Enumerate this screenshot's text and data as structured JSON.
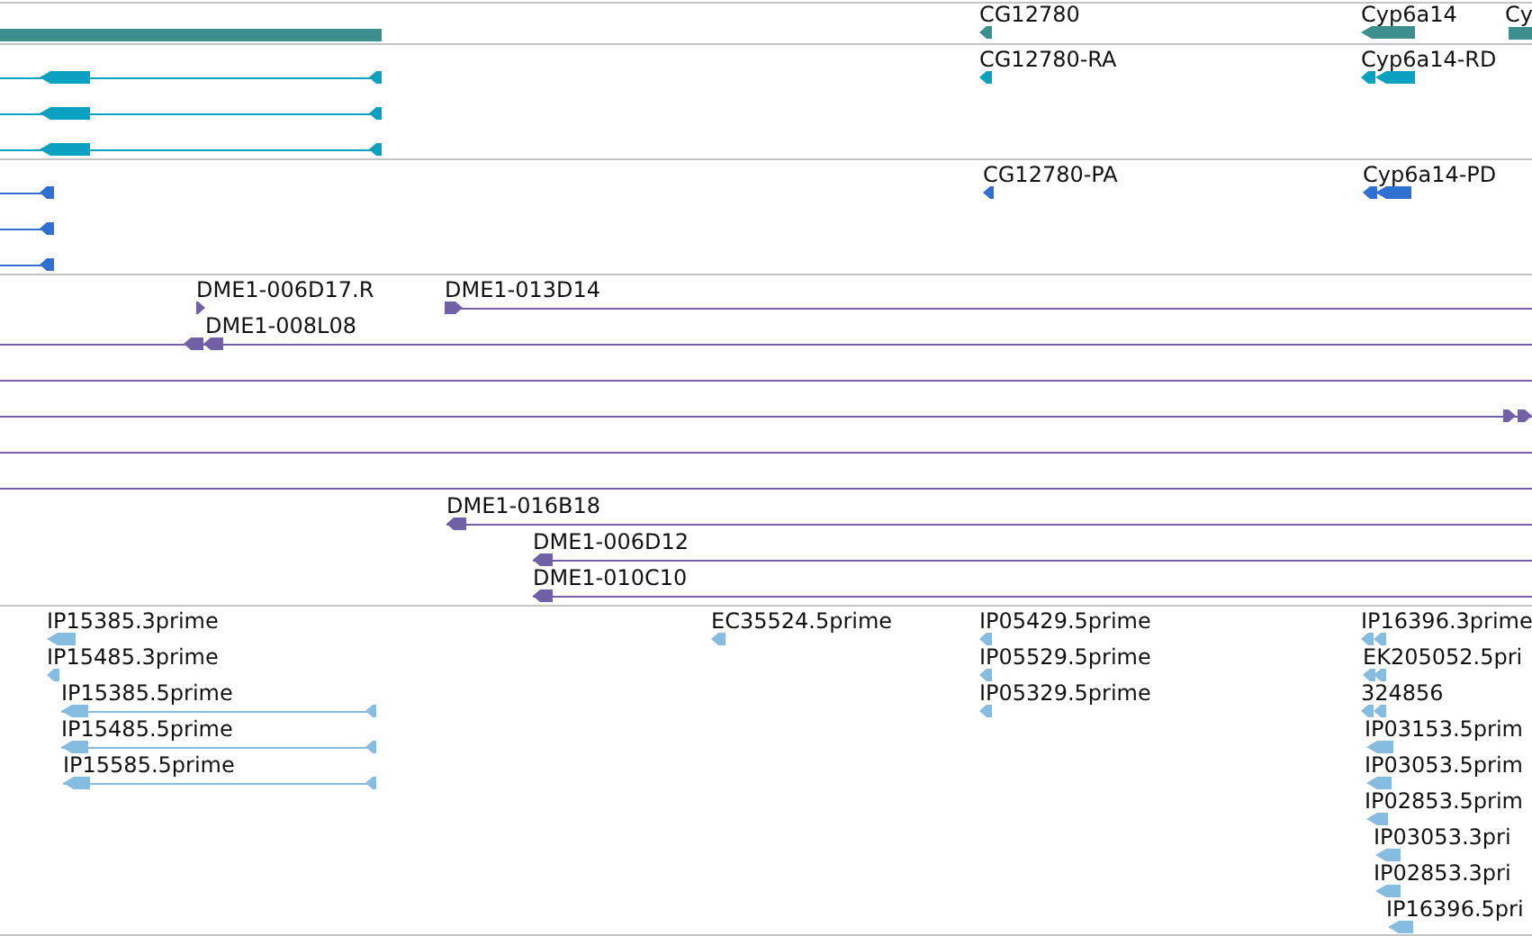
{
  "tracks": [
    {
      "color": "#3d8f8f",
      "features": [
        {
          "label": "CG12780"
        },
        {
          "label": "Cyp6a14"
        },
        {
          "label": "Cy"
        }
      ]
    },
    {
      "color": "#0aa0c0",
      "features": [
        {
          "label": "CG12780-RA"
        },
        {
          "label": "Cyp6a14-RD"
        }
      ]
    },
    {
      "color": "#3070d0",
      "features": [
        {
          "label": "CG12780-PA"
        },
        {
          "label": "Cyp6a14-PD"
        }
      ]
    },
    {
      "color": "#7060a8",
      "features": [
        {
          "label": "DME1-006D17.R"
        },
        {
          "label": "DME1-013D14"
        },
        {
          "label": "DME1-008L08"
        },
        {
          "label": "DME1-016B18"
        },
        {
          "label": "DME1-006D12"
        },
        {
          "label": "DME1-010C10"
        }
      ]
    },
    {
      "color": "#86bce0",
      "features": [
        {
          "label": "IP15385.3prime"
        },
        {
          "label": "IP15485.3prime"
        },
        {
          "label": "IP15385.5prime"
        },
        {
          "label": "IP15485.5prime"
        },
        {
          "label": "IP15585.5prime"
        },
        {
          "label": "EC35524.5prime"
        },
        {
          "label": "IP05429.5prime"
        },
        {
          "label": "IP05529.5prime"
        },
        {
          "label": "IP05329.5prime"
        },
        {
          "label": "IP16396.3prime"
        },
        {
          "label": "EK205052.5pri"
        },
        {
          "label": "324856"
        },
        {
          "label": "IP03153.5prim"
        },
        {
          "label": "IP03053.5prim"
        },
        {
          "label": "IP02853.5prim"
        },
        {
          "label": "IP03053.3pri"
        },
        {
          "label": "IP02853.3pri"
        },
        {
          "label": "IP16396.5pri"
        }
      ]
    }
  ]
}
